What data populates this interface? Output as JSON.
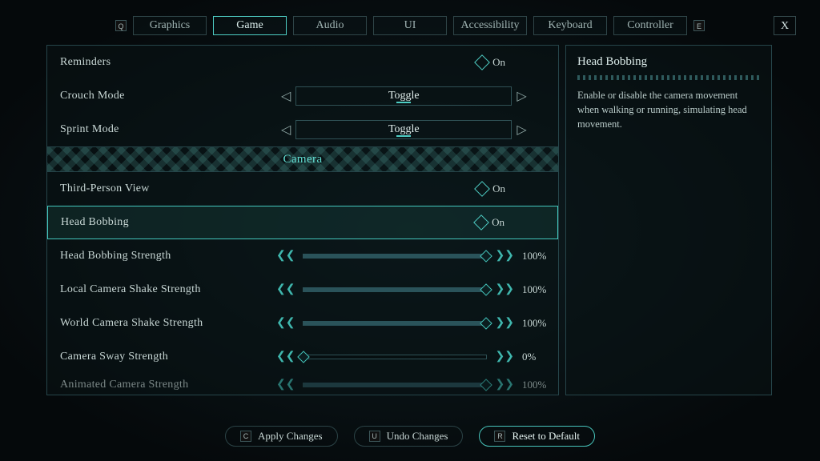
{
  "tabs": {
    "prev_key": "Q",
    "next_key": "E",
    "close": "X",
    "items": [
      "Graphics",
      "Game",
      "Audio",
      "UI",
      "Accessibility",
      "Keyboard",
      "Controller"
    ],
    "active_index": 1
  },
  "section": {
    "camera": "Camera"
  },
  "options": {
    "reminders": {
      "label": "Reminders",
      "value": "On"
    },
    "crouch": {
      "label": "Crouch Mode",
      "value": "Toggle"
    },
    "sprint": {
      "label": "Sprint Mode",
      "value": "Toggle"
    },
    "third_person": {
      "label": "Third-Person View",
      "value": "On"
    },
    "head_bobbing": {
      "label": "Head Bobbing",
      "value": "On"
    },
    "hb_strength": {
      "label": "Head Bobbing Strength",
      "value": "100%",
      "pct": 100
    },
    "local_shake": {
      "label": "Local Camera Shake Strength",
      "value": "100%",
      "pct": 100
    },
    "world_shake": {
      "label": "World Camera Shake Strength",
      "value": "100%",
      "pct": 100
    },
    "sway": {
      "label": "Camera Sway Strength",
      "value": "0%",
      "pct": 0
    },
    "anim_strength": {
      "label": "Animated Camera Strength",
      "value": "100%",
      "pct": 100
    }
  },
  "tooltip": {
    "title": "Head Bobbing",
    "desc": "Enable or disable the camera movement when walking or running, simulating head movement."
  },
  "footer": {
    "apply": {
      "key": "C",
      "label": "Apply Changes"
    },
    "undo": {
      "key": "U",
      "label": "Undo Changes"
    },
    "reset": {
      "key": "R",
      "label": "Reset to Default"
    }
  }
}
